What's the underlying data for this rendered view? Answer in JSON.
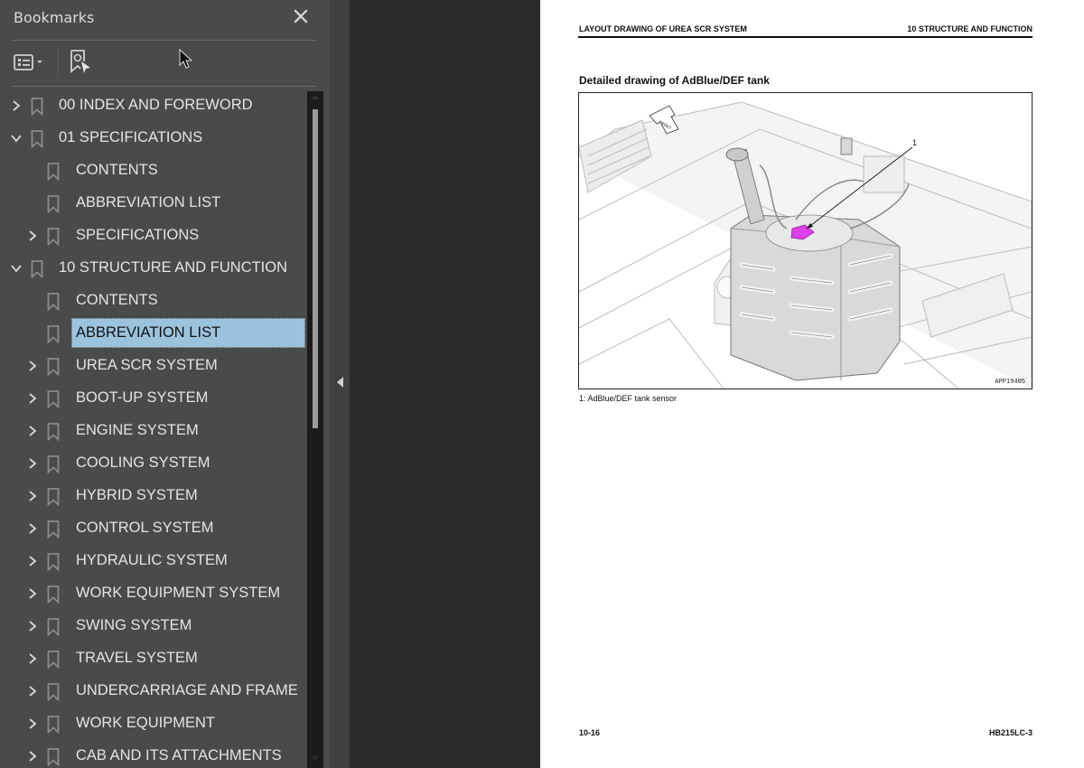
{
  "sidebar": {
    "title": "Bookmarks",
    "close_icon": "close-icon",
    "toolbar": {
      "options_icon": "list-options-icon",
      "find_icon": "find-current-bookmark-icon"
    },
    "items": [
      {
        "label": "00 INDEX AND FOREWORD",
        "level": 0,
        "state": "collapsed"
      },
      {
        "label": "01 SPECIFICATIONS",
        "level": 0,
        "state": "expanded"
      },
      {
        "label": "CONTENTS",
        "level": 1,
        "state": "leaf"
      },
      {
        "label": "ABBREVIATION LIST",
        "level": 1,
        "state": "leaf"
      },
      {
        "label": "SPECIFICATIONS",
        "level": 1,
        "state": "collapsed"
      },
      {
        "label": "10 STRUCTURE AND FUNCTION",
        "level": 0,
        "state": "expanded"
      },
      {
        "label": "CONTENTS",
        "level": 1,
        "state": "leaf"
      },
      {
        "label": "ABBREVIATION LIST",
        "level": 1,
        "state": "leaf",
        "selected": true
      },
      {
        "label": "UREA SCR SYSTEM",
        "level": 1,
        "state": "collapsed"
      },
      {
        "label": "BOOT-UP SYSTEM",
        "level": 1,
        "state": "collapsed"
      },
      {
        "label": "ENGINE SYSTEM",
        "level": 1,
        "state": "collapsed"
      },
      {
        "label": "COOLING SYSTEM",
        "level": 1,
        "state": "collapsed"
      },
      {
        "label": "HYBRID SYSTEM",
        "level": 1,
        "state": "collapsed"
      },
      {
        "label": "CONTROL SYSTEM",
        "level": 1,
        "state": "collapsed"
      },
      {
        "label": "HYDRAULIC SYSTEM",
        "level": 1,
        "state": "collapsed"
      },
      {
        "label": "WORK EQUIPMENT SYSTEM",
        "level": 1,
        "state": "collapsed"
      },
      {
        "label": "SWING SYSTEM",
        "level": 1,
        "state": "collapsed"
      },
      {
        "label": "TRAVEL SYSTEM",
        "level": 1,
        "state": "collapsed"
      },
      {
        "label": "UNDERCARRIAGE AND FRAME",
        "level": 1,
        "state": "collapsed"
      },
      {
        "label": "WORK EQUIPMENT",
        "level": 1,
        "state": "collapsed"
      },
      {
        "label": "CAB AND ITS ATTACHMENTS",
        "level": 1,
        "state": "collapsed"
      }
    ],
    "colors": {
      "background": "#4a4a4a",
      "selected": "#9cc3de",
      "text": "#e4e4e4"
    }
  },
  "collapse_handle": {
    "icon": "collapse-left-icon"
  },
  "page": {
    "header_left": "LAYOUT DRAWING OF UREA SCR SYSTEM",
    "header_right": "10 STRUCTURE AND FUNCTION",
    "section_title": "Detailed drawing of AdBlue/DEF tank",
    "figure": {
      "front_label": "FRONT",
      "callout_number": "1",
      "figure_id": "APP19405",
      "highlight_color": "#e040e8"
    },
    "caption": "1: AdBlue/DEF tank sensor",
    "footer_left": "10-16",
    "footer_right": "HB215LC-3"
  }
}
